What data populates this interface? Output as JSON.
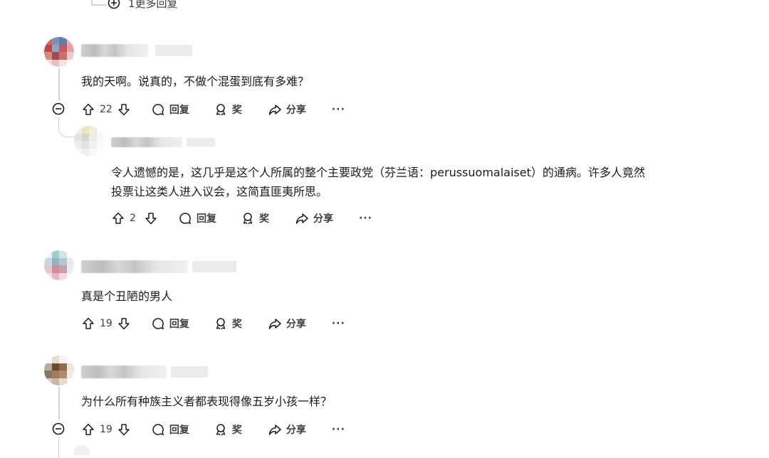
{
  "more_replies_label": "1更多回复",
  "actions": {
    "reply": "回复",
    "award": "奖",
    "share": "分享",
    "more": "···"
  },
  "comments": [
    {
      "text": "我的天啊。说真的，不做个混蛋到底有多难？",
      "votes": "22"
    },
    {
      "text_line1": "令人遗憾的是，这几乎是这个人所属的整个主要政党（芬兰语：perussuomalaiset）的通病。许多人竟然",
      "text_line2": "投票让这类人进入议会，这简直匪夷所思。",
      "votes": "2"
    },
    {
      "text": "真是个丑陋的男人",
      "votes": "19"
    },
    {
      "text": "为什么所有种族主义者都表现得像五岁小孩一样？",
      "votes": "19"
    }
  ],
  "icon_names": [
    "plus-circle-icon",
    "minus-circle-icon",
    "upvote-icon",
    "downvote-icon",
    "comment-icon",
    "award-icon",
    "share-icon",
    "more-icon"
  ]
}
